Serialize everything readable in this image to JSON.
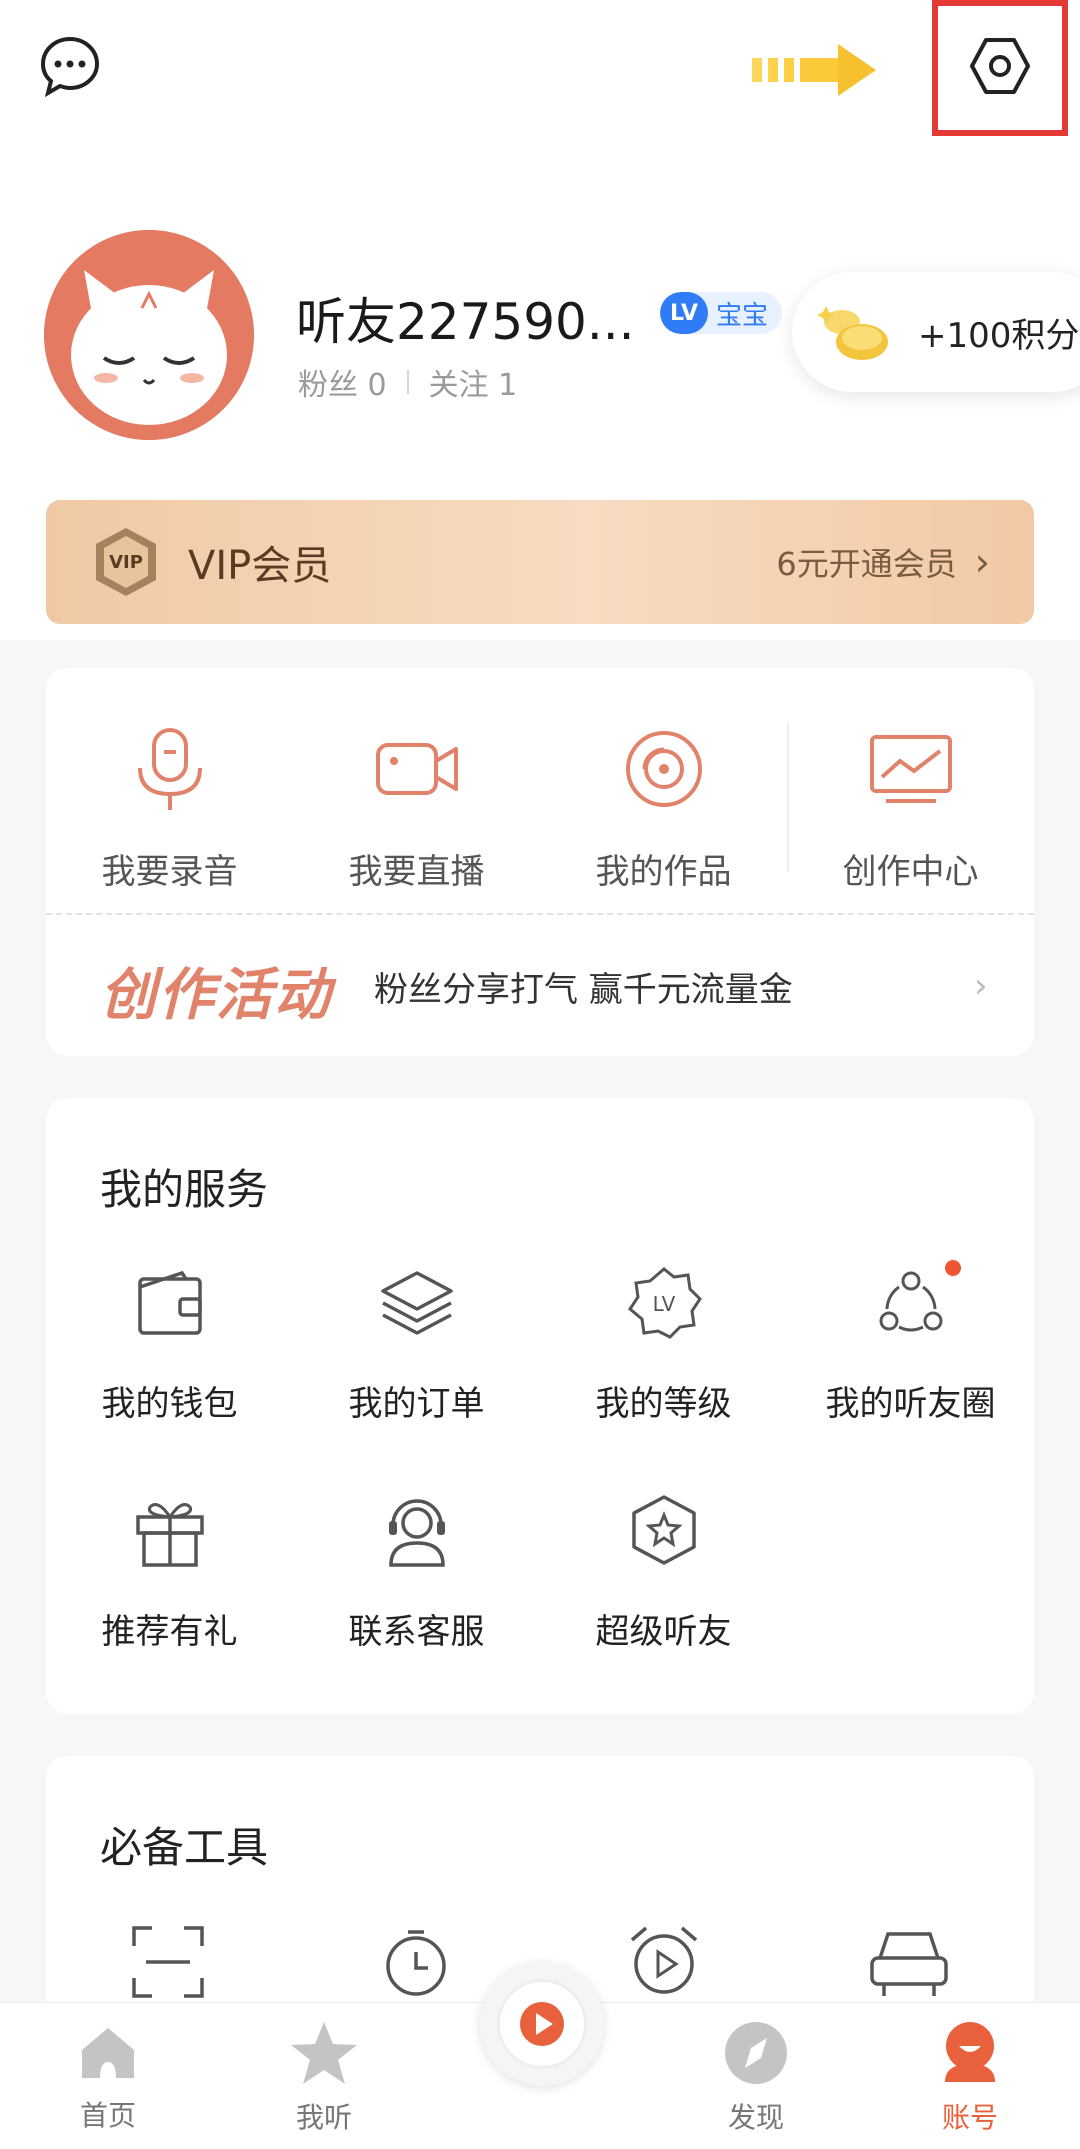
{
  "profile": {
    "username": "听友227590...",
    "level_badge": "LV",
    "level_name": "宝宝",
    "fans_label": "粉丝 0",
    "follow_label": "关注 1",
    "points_label": "+100积分"
  },
  "vip": {
    "title": "VIP会员",
    "cta": "6元开通会员",
    "chevron": "›"
  },
  "creator": {
    "items": [
      {
        "label": "我要录音",
        "icon": "microphone-icon"
      },
      {
        "label": "我要直播",
        "icon": "video-camera-icon"
      },
      {
        "label": "我的作品",
        "icon": "disc-icon"
      },
      {
        "label": "创作中心",
        "icon": "chart-monitor-icon"
      }
    ],
    "activity_title": "创作活动",
    "activity_text": "粉丝分享打气 赢千元流量金",
    "chevron": "›"
  },
  "services": {
    "title": "我的服务",
    "items": [
      {
        "label": "我的钱包",
        "icon": "wallet-icon"
      },
      {
        "label": "我的订单",
        "icon": "layers-icon"
      },
      {
        "label": "我的等级",
        "icon": "level-icon"
      },
      {
        "label": "我的听友圈",
        "icon": "circle-friends-icon"
      },
      {
        "label": "推荐有礼",
        "icon": "gift-icon"
      },
      {
        "label": "联系客服",
        "icon": "headset-icon"
      },
      {
        "label": "超级听友",
        "icon": "star-badge-icon"
      }
    ]
  },
  "tools": {
    "title": "必备工具"
  },
  "bottom_nav": {
    "items": [
      {
        "label": "首页",
        "icon": "home-icon"
      },
      {
        "label": "我听",
        "icon": "star-icon"
      },
      {
        "label": "发现",
        "icon": "compass-icon"
      },
      {
        "label": "账号",
        "icon": "account-icon"
      }
    ]
  },
  "colors": {
    "accent": "#e8603c",
    "icon_orange": "#e0836a",
    "vip_gold": "#f0c9a4",
    "lv_blue": "#2f7cf6",
    "highlight_red": "#e53935"
  }
}
